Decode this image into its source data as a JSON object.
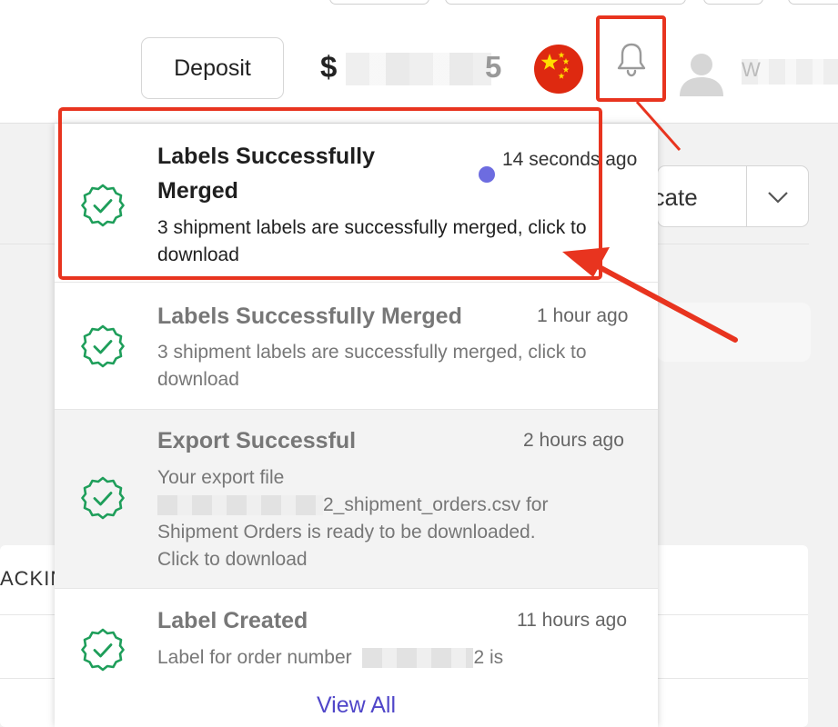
{
  "header": {
    "deposit_label": "Deposit",
    "balance_symbol": "$",
    "balance_tail": "5",
    "user_initial": "W"
  },
  "background": {
    "duplicate_label": "licate",
    "tracking_label": "ACKIN"
  },
  "notifications": {
    "items": [
      {
        "title": "Labels Successfully Merged",
        "time": "14 seconds ago",
        "unread": true,
        "body": "3 shipment labels are successfully merged, click to download"
      },
      {
        "title": "Labels Successfully Merged",
        "time": "1 hour ago",
        "unread": false,
        "body": "3 shipment labels are successfully merged, click to download"
      },
      {
        "title": "Export Successful",
        "time": "2 hours ago",
        "unread": false,
        "body_line1": "Your export file",
        "body_filename_suffix": "2_shipment_orders.csv for",
        "body_line3": "Shipment Orders is ready to be downloaded.",
        "body_line4": "Click to download"
      },
      {
        "title": "Label Created",
        "time": "11 hours ago",
        "unread": false,
        "body_prefix": "Label for order number",
        "body_suffix": "2 is"
      }
    ],
    "view_all_label": "View All"
  },
  "icons": {
    "notification": "bell-icon",
    "status": "badge-check-icon",
    "user": "user-avatar-icon",
    "language": "china-flag-icon",
    "dropdown": "chevron-down-icon"
  },
  "colors": {
    "annotation_red": "#e8341f",
    "success_green": "#1e9e5a",
    "unread_dot": "#6d6ce0",
    "link": "#5046c9"
  }
}
